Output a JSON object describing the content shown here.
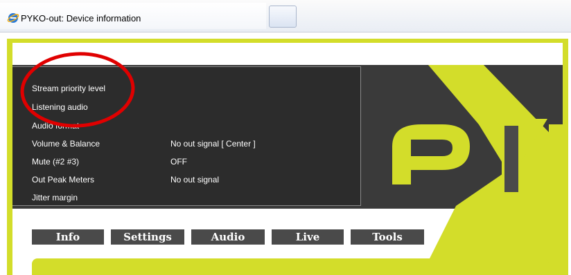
{
  "browser": {
    "tab_title": "PYKO-out: Device information"
  },
  "device_info": {
    "rows": [
      {
        "label": "Stream priority level",
        "value": ""
      },
      {
        "label": "Listening audio",
        "value": ""
      },
      {
        "label": "Audio format",
        "value": ""
      },
      {
        "label": "Volume & Balance",
        "value": "No out signal  [ Center ]"
      },
      {
        "label": "Mute (#2 #3)",
        "value": "OFF"
      },
      {
        "label": "Out Peak Meters",
        "value": "No out signal"
      },
      {
        "label": "Jitter margin",
        "value": ""
      }
    ]
  },
  "nav": {
    "items": [
      "Info",
      "Settings",
      "Audio",
      "Live",
      "Tools"
    ]
  },
  "colors": {
    "brand_lime": "#d3dd2a",
    "dark_bg": "#3a3a3a",
    "annotation": "#e00000"
  },
  "icons": {
    "browser_icon": "internet-explorer-icon"
  }
}
